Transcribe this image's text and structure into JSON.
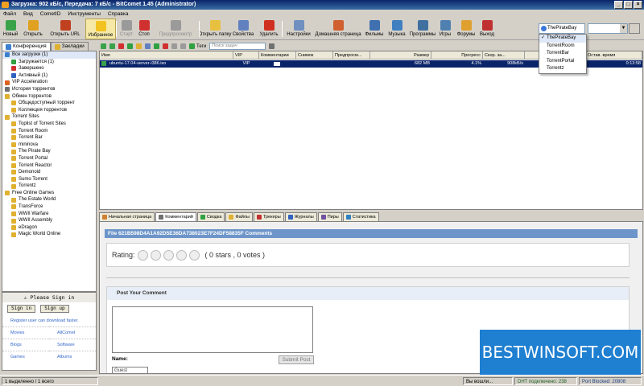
{
  "window": {
    "title": "Загрузка: 902 кБ/с, Передача: 7 кБ/с - BitComet 1.45 (Administrator)"
  },
  "menu": [
    "Файл",
    "Вид",
    "CometID",
    "Инструменты",
    "Справка"
  ],
  "toolbar": [
    {
      "label": "Новый",
      "icon": "new-icon",
      "color": "#3aa34a"
    },
    {
      "label": "Открыть",
      "icon": "open-icon",
      "color": "#e0a020"
    },
    {
      "label": "Открыть URL",
      "icon": "open-url-icon",
      "color": "#c04020"
    },
    {
      "label": "Избранное",
      "icon": "star-icon",
      "color": "#f2c320"
    },
    {
      "label": "Старт",
      "icon": "start-icon",
      "color": "#9a9a9a"
    },
    {
      "label": "Стоп",
      "icon": "stop-icon",
      "color": "#d03030"
    },
    {
      "label": "Предпросмотр",
      "icon": "preview-icon",
      "color": "#9a9a9a"
    },
    {
      "label": "Открыть папку",
      "icon": "folder-icon",
      "color": "#e8c040"
    },
    {
      "label": "Свойства",
      "icon": "properties-icon",
      "color": "#6080c0"
    },
    {
      "label": "Удалить",
      "icon": "delete-icon",
      "color": "#d03020"
    },
    {
      "label": "Настройки",
      "icon": "settings-icon",
      "color": "#7090c0"
    },
    {
      "label": "Домашняя страница",
      "icon": "home-icon",
      "color": "#d06030"
    },
    {
      "label": "Фильмы",
      "icon": "movies-icon",
      "color": "#4070b0"
    },
    {
      "label": "Музыка",
      "icon": "music-icon",
      "color": "#4080c0"
    },
    {
      "label": "Программы",
      "icon": "programs-icon",
      "color": "#4070a0"
    },
    {
      "label": "Игры",
      "icon": "games-icon",
      "color": "#5080b0"
    },
    {
      "label": "Форумы",
      "icon": "forums-icon",
      "color": "#e0a030"
    },
    {
      "label": "Выход",
      "icon": "exit-icon",
      "color": "#c03030"
    }
  ],
  "search": {
    "engine": "ThePirateBay",
    "options": [
      "ThePirateBay",
      "TorrentRoom",
      "TorrentBar",
      "TorrentPortal",
      "Torrentz"
    ]
  },
  "left_tabs": [
    "Конференция",
    "Закладки"
  ],
  "tree": [
    {
      "label": "Все загрузки (1)",
      "level": 0,
      "color": "#3a7fd0",
      "selected": true
    },
    {
      "label": "Загружается (1)",
      "level": 1,
      "color": "#30a040"
    },
    {
      "label": "Завершено",
      "level": 1,
      "color": "#d03030"
    },
    {
      "label": "Активный (1)",
      "level": 1,
      "color": "#3060c0"
    },
    {
      "label": "VIP Acceleration",
      "level": 0,
      "color": "#e06020"
    },
    {
      "label": "История торрентов",
      "level": 0,
      "color": "#707070"
    },
    {
      "label": "Обмен торрентов",
      "level": 0,
      "color": "#e0b030"
    },
    {
      "label": "Общедоступный торрент",
      "level": 1,
      "color": "#e0b030"
    },
    {
      "label": "Коллекция торрентов",
      "level": 1,
      "color": "#e0b030"
    },
    {
      "label": "Torrent Sites",
      "level": 0,
      "color": "#e0b030"
    },
    {
      "label": "Toplist of Torrent Sites",
      "level": 1,
      "color": "#e0b030"
    },
    {
      "label": "Torrent Room",
      "level": 1,
      "color": "#e0b030"
    },
    {
      "label": "Torrent Bar",
      "level": 1,
      "color": "#e0b030"
    },
    {
      "label": "mininova",
      "level": 1,
      "color": "#e0b030"
    },
    {
      "label": "The Pirate Bay",
      "level": 1,
      "color": "#e0b030"
    },
    {
      "label": "Torrent Portal",
      "level": 1,
      "color": "#e0b030"
    },
    {
      "label": "Torrent Reactor",
      "level": 1,
      "color": "#e0b030"
    },
    {
      "label": "Demonoid",
      "level": 1,
      "color": "#e0b030"
    },
    {
      "label": "Sumo Torrent",
      "level": 1,
      "color": "#e0b030"
    },
    {
      "label": "Torrentz",
      "level": 1,
      "color": "#e0b030"
    },
    {
      "label": "Free Online Games",
      "level": 0,
      "color": "#e0b030"
    },
    {
      "label": "The Estate World",
      "level": 1,
      "color": "#e0b030"
    },
    {
      "label": "TransForce",
      "level": 1,
      "color": "#e0b030"
    },
    {
      "label": "WWII Warfare",
      "level": 1,
      "color": "#e0b030"
    },
    {
      "label": "WWII Assembly",
      "level": 1,
      "color": "#e0b030"
    },
    {
      "label": "eDragon",
      "level": 1,
      "color": "#e0b030"
    },
    {
      "label": "Magic World Online",
      "level": 1,
      "color": "#e0b030"
    }
  ],
  "signin": {
    "header": "Please Sign in",
    "signin_label": "Sign in",
    "signup_label": "Sign up",
    "register_text": "Register user can download faster.",
    "links": [
      "Movies",
      "AllComet",
      "Blogs",
      "Software",
      "Games",
      "Albums"
    ]
  },
  "dl_toolbar": {
    "tags_label": "Теги",
    "search_placeholder": "Поиск задач"
  },
  "table": {
    "columns": [
      "Имя",
      "VIP",
      "Комментарии",
      "Снимок",
      "Предпросм...",
      "Размер",
      "Прогресс",
      "Скор. за...",
      "",
      "Остав. время"
    ],
    "rows": [
      {
        "name": "ubuntu-17.04-server-i386.iso",
        "vip": "VIP",
        "size": "682 MB",
        "progress": "4.1%",
        "speed": "908kB/s",
        "remaining": "0:13:58"
      }
    ]
  },
  "detail_tabs": [
    "Начальная страница",
    "Комментарий",
    "Сводка",
    "Файлы",
    "Трекеры",
    "Журналы",
    "Пиры",
    "Статистика"
  ],
  "comments": {
    "file_header": "File 621B598D4A1A92D5E36DA738023E7F24DF58835F Comments",
    "rating_label": "Rating:",
    "rating_text": "( 0 stars , 0 votes )",
    "post_title": "Post Your Comment",
    "name_label": "Name:",
    "submit_label": "Submit Post",
    "name_value": "Guest"
  },
  "watermark": "BESTWINSOFT.COM",
  "status": {
    "selection": "1 выделенно / 1 всего",
    "speed_mode": "Вы вошли...",
    "dht": "DHT подключено: 238",
    "port": "Port Blocked: 20808"
  }
}
